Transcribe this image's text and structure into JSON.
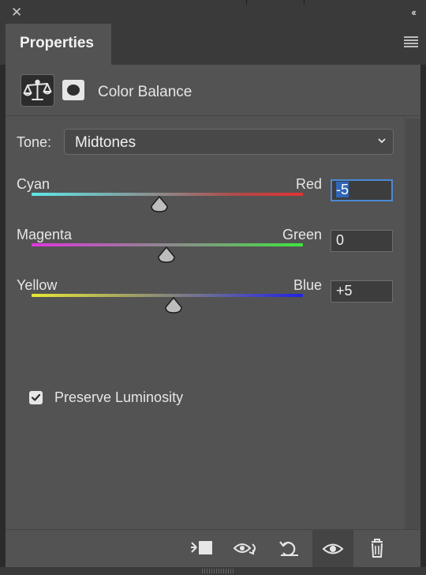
{
  "window": {
    "close_glyph": "✕",
    "collapse_glyph": "‹‹"
  },
  "tab": {
    "label": "Properties"
  },
  "adjustment": {
    "title": "Color Balance",
    "icon": "balance-scale-icon",
    "mask_icon": "layer-mask-icon"
  },
  "tone": {
    "label": "Tone:",
    "selected": "Midtones"
  },
  "sliders": [
    {
      "left": "Cyan",
      "right": "Red",
      "value": "-5",
      "left_color": "#5ee7e7",
      "right_color": "#e23333"
    },
    {
      "left": "Magenta",
      "right": "Green",
      "value": "0",
      "left_color": "#e035e0",
      "right_color": "#3ee63e"
    },
    {
      "left": "Yellow",
      "right": "Blue",
      "value": "+5",
      "left_color": "#e8e836",
      "right_color": "#2222e8"
    }
  ],
  "preserve": {
    "label": "Preserve Luminosity",
    "checked": true
  },
  "toolbar": {
    "icons": [
      "clip-to-layer-icon",
      "view-previous-state-icon",
      "reset-icon",
      "visibility-eye-icon",
      "trash-icon"
    ]
  },
  "colors": {
    "panel": "#535353",
    "chrome": "#3a3a3a",
    "accent": "#4b8ad6"
  }
}
